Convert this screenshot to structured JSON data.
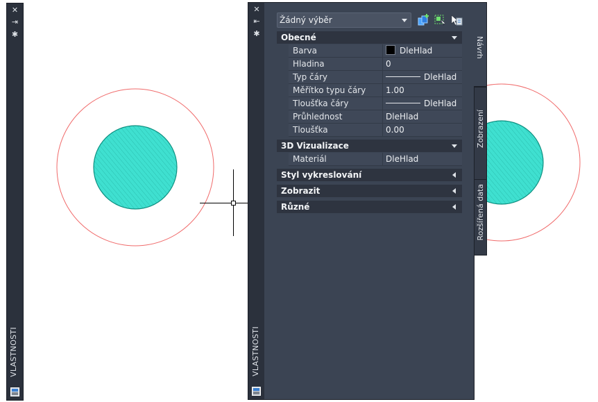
{
  "left_palette": {
    "close_glyph": "✕",
    "autohide_glyph": "⇥",
    "settings_glyph": "✱",
    "title": "VLASTNOSTI"
  },
  "palette": {
    "close_glyph": "✕",
    "autohide_glyph": "⇤",
    "settings_glyph": "✱",
    "title": "VLASTNOSTI"
  },
  "selector": {
    "value": "Žádný výběr"
  },
  "toolbar_icons": [
    "quick-select-icon",
    "select-objects-icon",
    "pickadd-icon"
  ],
  "sections": {
    "general": {
      "title": "Obecné",
      "rows": [
        {
          "name": "Barva",
          "value": "DleHlad",
          "swatch": "#000000"
        },
        {
          "name": "Hladina",
          "value": "0"
        },
        {
          "name": "Typ čáry",
          "value": "DleHlad",
          "line": true
        },
        {
          "name": "Měřítko typu čáry",
          "value": "1.00"
        },
        {
          "name": "Tloušťka čáry",
          "value": "DleHlad",
          "line": true
        },
        {
          "name": "Průhlednost",
          "value": "DleHlad"
        },
        {
          "name": "Tloušťka",
          "value": "0.00"
        }
      ]
    },
    "viz3d": {
      "title": "3D Vizualizace",
      "rows": [
        {
          "name": "Materiál",
          "value": "DleHlad"
        }
      ]
    },
    "plot_style": {
      "title": "Styl vykreslování"
    },
    "view": {
      "title": "Zobrazit"
    },
    "misc": {
      "title": "Různé"
    }
  },
  "side_tabs": {
    "design": "Návrh",
    "display": "Zobrazení",
    "extended": "Rozšířená data"
  },
  "colors": {
    "circle_outline": "#f06a6a",
    "hatch_fill": "#3fe0d0",
    "hatch_stroke": "#0e8f80"
  }
}
